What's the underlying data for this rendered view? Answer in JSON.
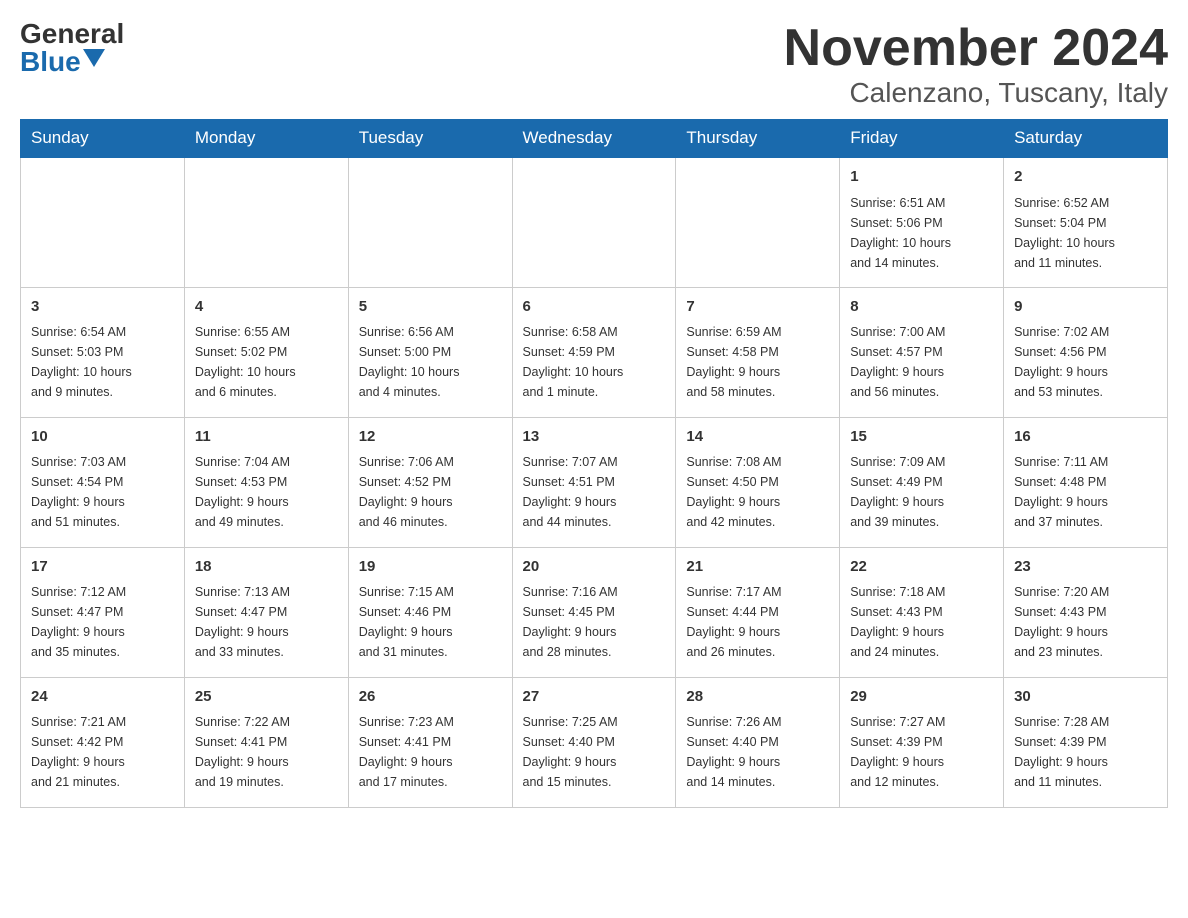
{
  "header": {
    "logo_general": "General",
    "logo_blue": "Blue",
    "month_year": "November 2024",
    "location": "Calenzano, Tuscany, Italy"
  },
  "days_of_week": [
    "Sunday",
    "Monday",
    "Tuesday",
    "Wednesday",
    "Thursday",
    "Friday",
    "Saturday"
  ],
  "weeks": [
    [
      {
        "day": "",
        "info": ""
      },
      {
        "day": "",
        "info": ""
      },
      {
        "day": "",
        "info": ""
      },
      {
        "day": "",
        "info": ""
      },
      {
        "day": "",
        "info": ""
      },
      {
        "day": "1",
        "info": "Sunrise: 6:51 AM\nSunset: 5:06 PM\nDaylight: 10 hours\nand 14 minutes."
      },
      {
        "day": "2",
        "info": "Sunrise: 6:52 AM\nSunset: 5:04 PM\nDaylight: 10 hours\nand 11 minutes."
      }
    ],
    [
      {
        "day": "3",
        "info": "Sunrise: 6:54 AM\nSunset: 5:03 PM\nDaylight: 10 hours\nand 9 minutes."
      },
      {
        "day": "4",
        "info": "Sunrise: 6:55 AM\nSunset: 5:02 PM\nDaylight: 10 hours\nand 6 minutes."
      },
      {
        "day": "5",
        "info": "Sunrise: 6:56 AM\nSunset: 5:00 PM\nDaylight: 10 hours\nand 4 minutes."
      },
      {
        "day": "6",
        "info": "Sunrise: 6:58 AM\nSunset: 4:59 PM\nDaylight: 10 hours\nand 1 minute."
      },
      {
        "day": "7",
        "info": "Sunrise: 6:59 AM\nSunset: 4:58 PM\nDaylight: 9 hours\nand 58 minutes."
      },
      {
        "day": "8",
        "info": "Sunrise: 7:00 AM\nSunset: 4:57 PM\nDaylight: 9 hours\nand 56 minutes."
      },
      {
        "day": "9",
        "info": "Sunrise: 7:02 AM\nSunset: 4:56 PM\nDaylight: 9 hours\nand 53 minutes."
      }
    ],
    [
      {
        "day": "10",
        "info": "Sunrise: 7:03 AM\nSunset: 4:54 PM\nDaylight: 9 hours\nand 51 minutes."
      },
      {
        "day": "11",
        "info": "Sunrise: 7:04 AM\nSunset: 4:53 PM\nDaylight: 9 hours\nand 49 minutes."
      },
      {
        "day": "12",
        "info": "Sunrise: 7:06 AM\nSunset: 4:52 PM\nDaylight: 9 hours\nand 46 minutes."
      },
      {
        "day": "13",
        "info": "Sunrise: 7:07 AM\nSunset: 4:51 PM\nDaylight: 9 hours\nand 44 minutes."
      },
      {
        "day": "14",
        "info": "Sunrise: 7:08 AM\nSunset: 4:50 PM\nDaylight: 9 hours\nand 42 minutes."
      },
      {
        "day": "15",
        "info": "Sunrise: 7:09 AM\nSunset: 4:49 PM\nDaylight: 9 hours\nand 39 minutes."
      },
      {
        "day": "16",
        "info": "Sunrise: 7:11 AM\nSunset: 4:48 PM\nDaylight: 9 hours\nand 37 minutes."
      }
    ],
    [
      {
        "day": "17",
        "info": "Sunrise: 7:12 AM\nSunset: 4:47 PM\nDaylight: 9 hours\nand 35 minutes."
      },
      {
        "day": "18",
        "info": "Sunrise: 7:13 AM\nSunset: 4:47 PM\nDaylight: 9 hours\nand 33 minutes."
      },
      {
        "day": "19",
        "info": "Sunrise: 7:15 AM\nSunset: 4:46 PM\nDaylight: 9 hours\nand 31 minutes."
      },
      {
        "day": "20",
        "info": "Sunrise: 7:16 AM\nSunset: 4:45 PM\nDaylight: 9 hours\nand 28 minutes."
      },
      {
        "day": "21",
        "info": "Sunrise: 7:17 AM\nSunset: 4:44 PM\nDaylight: 9 hours\nand 26 minutes."
      },
      {
        "day": "22",
        "info": "Sunrise: 7:18 AM\nSunset: 4:43 PM\nDaylight: 9 hours\nand 24 minutes."
      },
      {
        "day": "23",
        "info": "Sunrise: 7:20 AM\nSunset: 4:43 PM\nDaylight: 9 hours\nand 23 minutes."
      }
    ],
    [
      {
        "day": "24",
        "info": "Sunrise: 7:21 AM\nSunset: 4:42 PM\nDaylight: 9 hours\nand 21 minutes."
      },
      {
        "day": "25",
        "info": "Sunrise: 7:22 AM\nSunset: 4:41 PM\nDaylight: 9 hours\nand 19 minutes."
      },
      {
        "day": "26",
        "info": "Sunrise: 7:23 AM\nSunset: 4:41 PM\nDaylight: 9 hours\nand 17 minutes."
      },
      {
        "day": "27",
        "info": "Sunrise: 7:25 AM\nSunset: 4:40 PM\nDaylight: 9 hours\nand 15 minutes."
      },
      {
        "day": "28",
        "info": "Sunrise: 7:26 AM\nSunset: 4:40 PM\nDaylight: 9 hours\nand 14 minutes."
      },
      {
        "day": "29",
        "info": "Sunrise: 7:27 AM\nSunset: 4:39 PM\nDaylight: 9 hours\nand 12 minutes."
      },
      {
        "day": "30",
        "info": "Sunrise: 7:28 AM\nSunset: 4:39 PM\nDaylight: 9 hours\nand 11 minutes."
      }
    ]
  ]
}
